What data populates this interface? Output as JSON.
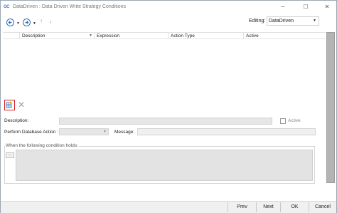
{
  "window": {
    "app_logo": "GC",
    "title": "DataDriven : Data Driven Write Strategy Conditions",
    "minimize": "─",
    "maximize": "☐",
    "close": "✕"
  },
  "toolbar": {
    "editing_label": "Editing:",
    "editing_value": "DataDriven"
  },
  "grid": {
    "columns": [
      "Description",
      "Expression",
      "Action Type",
      "Active"
    ]
  },
  "form": {
    "description_label": "Description:",
    "active_label": "Active",
    "perform_label": "Perform Database Action :",
    "message_label": "Message:",
    "condition_group_label": "When the following condition holds:",
    "expr_button": "..."
  },
  "footer": {
    "prev": "Prev",
    "next": "Next",
    "ok": "OK",
    "cancel": "Cancel"
  },
  "colors": {
    "accent": "#2f6db5",
    "add_highlight": "#d32020",
    "scrollbar": "#b4b4b4"
  }
}
